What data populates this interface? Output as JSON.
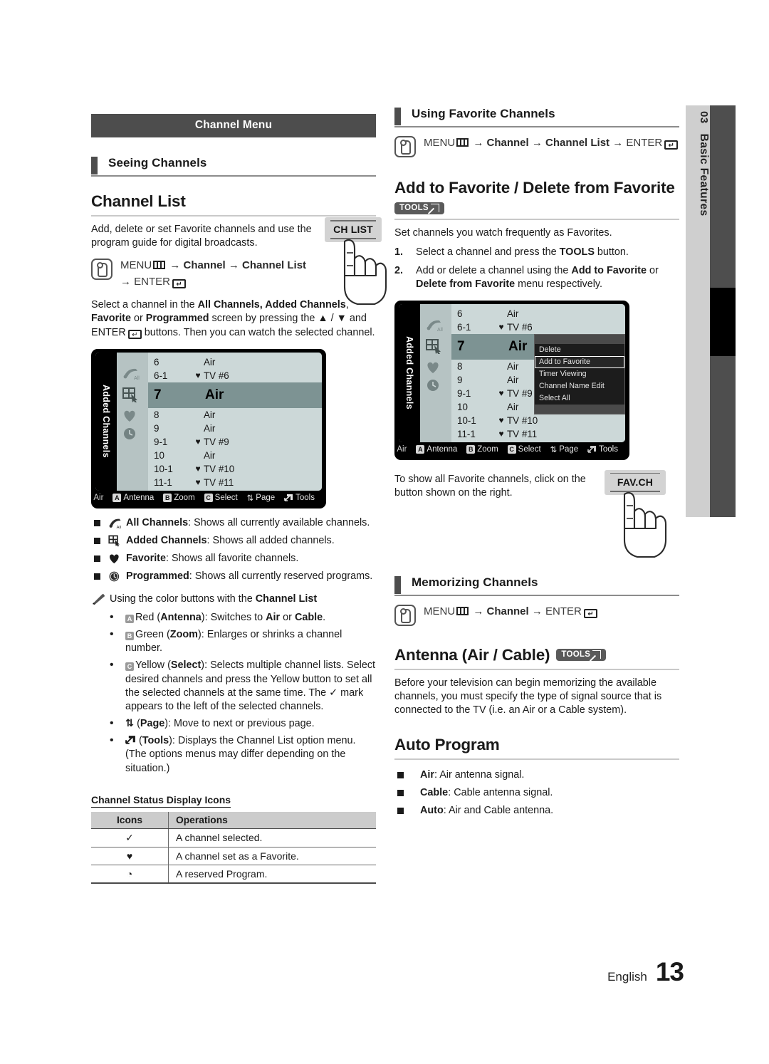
{
  "page": {
    "number": "13",
    "language": "English",
    "tab_number": "03",
    "tab_label": "Basic Features"
  },
  "left": {
    "menu_bar": "Channel Menu",
    "section_heading": "Seeing Channels",
    "h2_channel_list": "Channel List",
    "intro": "Add, delete or set Favorite channels and use the program guide for digital broadcasts.",
    "menu_path": {
      "menu": "MENU",
      "arrow": "→",
      "channel": "Channel",
      "channel_list": "Channel List",
      "enter": "ENTER"
    },
    "select_paragraph_pre": "Select a channel in the ",
    "select_bold_1": "All Channels, Added Channels",
    "select_mid_1": ", ",
    "select_bold_2": "Favorite",
    "select_mid_2": " or ",
    "select_bold_3": "Programmed",
    "select_post": " screen by pressing the ▲ / ▼ and ENTER",
    "select_post2": " buttons. Then you can watch the selected channel.",
    "remote_key": "CH LIST",
    "bullets": [
      {
        "icon": "all-channels-icon",
        "label": "All Channels",
        "text": ": Shows all currently available channels."
      },
      {
        "icon": "added-channels-icon",
        "label": "Added Channels",
        "text": ": Shows all added channels."
      },
      {
        "icon": "heart-icon",
        "label": "Favorite",
        "text": ": Shows all favorite channels."
      },
      {
        "icon": "clock-icon",
        "label": "Programmed",
        "text": ": Shows all currently reserved programs."
      }
    ],
    "note_pre": "Using the color buttons with the ",
    "note_bold": "Channel List",
    "color_buttons": [
      {
        "key": "A",
        "color_name": "Red",
        "fn": "Antenna",
        "text_pre": "Red (",
        "text_post": "): Switches to ",
        "b1": "Air",
        "mid": " or ",
        "b2": "Cable",
        "end": "."
      },
      {
        "key": "B",
        "color_name": "Green",
        "fn": "Zoom",
        "text_pre": "Green (",
        "text_post": "): Enlarges or shrinks a channel number."
      },
      {
        "key": "C",
        "color_name": "Yellow",
        "fn": "Select",
        "text_pre": "Yellow (",
        "text_post": "): Selects multiple channel lists. Select desired channels and press the Yellow button to set all the selected channels at the same time. The ✓ mark appears to the left of the selected channels."
      },
      {
        "key": "⇅",
        "color_name": "",
        "fn": "Page",
        "text_pre": "(",
        "text_post": "): Move to next or previous page."
      },
      {
        "key": "tools",
        "color_name": "",
        "fn": "Tools",
        "text_pre": "(",
        "text_post": "): Displays the Channel List option menu. (The options menus may differ depending on the situation.)"
      }
    ],
    "table": {
      "caption": "Channel Status Display Icons",
      "headers": [
        "Icons",
        "Operations"
      ],
      "rows": [
        {
          "icon": "✓",
          "op": "A channel selected."
        },
        {
          "icon": "♥",
          "op": "A channel set as a Favorite."
        },
        {
          "icon": "◔",
          "op": "A reserved Program."
        }
      ]
    }
  },
  "right": {
    "section_heading_fav": "Using Favorite Channels",
    "menu_path": {
      "menu": "MENU",
      "channel": "Channel",
      "channel_list": "Channel List",
      "enter": "ENTER"
    },
    "h2_add_fav": "Add to Favorite / Delete from Favorite",
    "tools_badge": "TOOLS",
    "fav_intro": "Set channels you watch frequently as Favorites.",
    "steps": [
      {
        "n": "1.",
        "pre": "Select a channel and press the ",
        "b": "TOOLS",
        "post": " button."
      },
      {
        "n": "2.",
        "pre": "Add or delete a channel using the ",
        "b": "Add to Favorite",
        "mid": " or ",
        "b2": "Delete from Favorite",
        "post": " menu respectively."
      }
    ],
    "fav_note": "To show all Favorite channels, click on the button shown on the right.",
    "remote_key": "FAV.CH",
    "section_heading_mem": "Memorizing Channels",
    "h2_antenna": "Antenna (Air / Cable)",
    "antenna_text": "Before your television can begin memorizing the available channels, you must specify the type of signal source that is connected to the TV (i.e. an Air or a Cable system).",
    "h2_auto": "Auto Program",
    "auto_bullets": [
      {
        "label": "Air",
        "text": ": Air antenna signal."
      },
      {
        "label": "Cable",
        "text": ": Cable antenna signal."
      },
      {
        "label": "Auto",
        "text": ": Air and Cable antenna."
      }
    ]
  },
  "tv_screen": {
    "side_label": "Added Channels",
    "rows": [
      {
        "num": "6",
        "fav": "",
        "name": "Air",
        "selected": false
      },
      {
        "num": "6-1",
        "fav": "♥",
        "name": "TV #6",
        "selected": false
      },
      {
        "num": "7",
        "fav": "",
        "name": "Air",
        "selected": true
      },
      {
        "num": "8",
        "fav": "",
        "name": "Air",
        "selected": false
      },
      {
        "num": "9",
        "fav": "",
        "name": "Air",
        "selected": false
      },
      {
        "num": "9-1",
        "fav": "♥",
        "name": "TV #9",
        "selected": false
      },
      {
        "num": "10",
        "fav": "",
        "name": "Air",
        "selected": false
      },
      {
        "num": "10-1",
        "fav": "♥",
        "name": "TV #10",
        "selected": false
      },
      {
        "num": "11-1",
        "fav": "♥",
        "name": "TV #11",
        "selected": false
      }
    ],
    "bottom_bar": {
      "source": "Air",
      "keys": [
        {
          "key": "A",
          "label": "Antenna"
        },
        {
          "key": "B",
          "label": "Zoom"
        },
        {
          "key": "C",
          "label": "Select"
        },
        {
          "key": "⇅",
          "label": "Page"
        },
        {
          "key": "tools",
          "label": "Tools"
        }
      ]
    },
    "tools_menu": {
      "items": [
        "Delete",
        "Add to Favorite",
        "Timer Viewing",
        "Channel Name Edit",
        "Select All"
      ],
      "highlighted": "Add to Favorite"
    }
  },
  "colors": {
    "header_bar": "#4d4d4d",
    "tab_bg": "#cfcfcf",
    "tab_bar": "#4e4e4e",
    "tv_list_bg": "#ccd8d8",
    "tv_selected": "#7d9393",
    "tv_icon_col": "#b6c3c3",
    "remote_key": "#d3d3d3",
    "table_header": "#cccccc"
  }
}
